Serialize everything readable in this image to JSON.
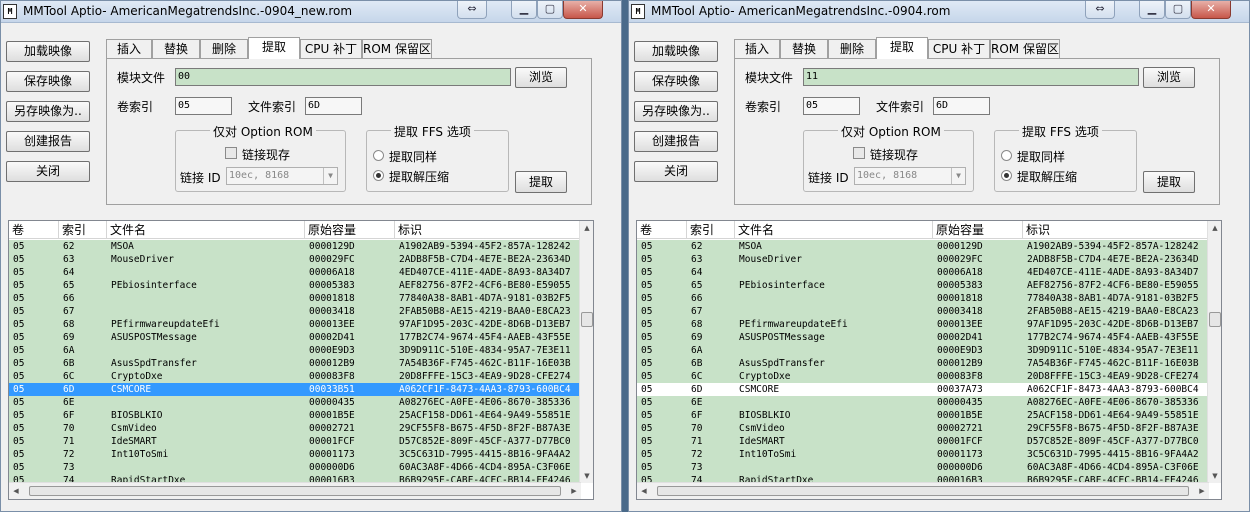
{
  "colors": {
    "row_green": "#c8e2c8",
    "selected": "#3399ff"
  },
  "windows": [
    {
      "title": "MMTool Aptio- AmericanMegatrendsInc.-0904_new.rom",
      "icon_text": "M",
      "side_buttons": [
        "加载映像",
        "保存映像",
        "另存映像为..",
        "创建报告",
        "关闭"
      ],
      "tabs": [
        "插入",
        "替换",
        "删除",
        "提取",
        "CPU 补丁",
        "ROM 保留区"
      ],
      "active_tab": 3,
      "module_file_label": "模块文件",
      "module_file_value": "00",
      "browse": "浏览",
      "volume_label": "卷索引",
      "volume_value": "05",
      "file_index_label": "文件索引",
      "file_index_value": "6D",
      "option_rom_title": "仅对 Option ROM",
      "link_existing": "链接现存",
      "link_id_label": "链接 ID",
      "link_id_value": "10ec, 8168",
      "ffs_title": "提取 FFS 选项",
      "extract_as_is": "提取同样",
      "extract_decompressed": "提取解压缩",
      "extract_button": "提取",
      "columns": [
        "卷",
        "索引",
        "文件名",
        "原始容量",
        "标识"
      ],
      "rows": [
        {
          "vol": "05",
          "idx": "62",
          "name": "MSOA",
          "size": "0000129D",
          "guid": "A1902AB9-5394-45F2-857A-128242",
          "sel": false
        },
        {
          "vol": "05",
          "idx": "63",
          "name": "MouseDriver",
          "size": "000029FC",
          "guid": "2ADB8F5B-C7D4-4E7E-BE2A-23634D",
          "sel": false
        },
        {
          "vol": "05",
          "idx": "64",
          "name": "",
          "size": "00006A18",
          "guid": "4ED407CE-411E-4ADE-8A93-8A34D7",
          "sel": false
        },
        {
          "vol": "05",
          "idx": "65",
          "name": "PEbiosinterface",
          "size": "00005383",
          "guid": "AEF82756-87F2-4CF6-BE80-E59055",
          "sel": false
        },
        {
          "vol": "05",
          "idx": "66",
          "name": "",
          "size": "00001818",
          "guid": "77840A38-8AB1-4D7A-9181-03B2F5",
          "sel": false
        },
        {
          "vol": "05",
          "idx": "67",
          "name": "",
          "size": "00003418",
          "guid": "2FAB50B8-AE15-4219-BAA0-E8CA23",
          "sel": false
        },
        {
          "vol": "05",
          "idx": "68",
          "name": "PEfirmwareupdateEfi",
          "size": "000013EE",
          "guid": "97AF1D95-203C-42DE-8D6B-D13EB7",
          "sel": false
        },
        {
          "vol": "05",
          "idx": "69",
          "name": "ASUSPOSTMessage",
          "size": "00002D41",
          "guid": "177B2C74-9674-45F4-AAEB-43F55E",
          "sel": false
        },
        {
          "vol": "05",
          "idx": "6A",
          "name": "",
          "size": "0000E9D3",
          "guid": "3D9D911C-510E-4834-95A7-7E3E11",
          "sel": false
        },
        {
          "vol": "05",
          "idx": "6B",
          "name": "AsusSpdTransfer",
          "size": "000012B9",
          "guid": "7A54B36F-F745-462C-B11F-16E03B",
          "sel": false
        },
        {
          "vol": "05",
          "idx": "6C",
          "name": "CryptoDxe",
          "size": "000083F8",
          "guid": "20D8FFFE-15C3-4EA9-9D28-CFE274",
          "sel": false
        },
        {
          "vol": "05",
          "idx": "6D",
          "name": "CSMCORE",
          "size": "00033B51",
          "guid": "A062CF1F-8473-4AA3-8793-600BC4",
          "sel": true
        },
        {
          "vol": "05",
          "idx": "6E",
          "name": "",
          "size": "00000435",
          "guid": "A08276EC-A0FE-4E06-8670-385336",
          "sel": false
        },
        {
          "vol": "05",
          "idx": "6F",
          "name": "BIOSBLKIO",
          "size": "00001B5E",
          "guid": "25ACF158-DD61-4E64-9A49-55851E",
          "sel": false
        },
        {
          "vol": "05",
          "idx": "70",
          "name": "CsmVideo",
          "size": "00002721",
          "guid": "29CF55F8-B675-4F5D-8F2F-B87A3E",
          "sel": false
        },
        {
          "vol": "05",
          "idx": "71",
          "name": "IdeSMART",
          "size": "00001FCF",
          "guid": "D57C852E-809F-45CF-A377-D77BC0",
          "sel": false
        },
        {
          "vol": "05",
          "idx": "72",
          "name": "Int10ToSmi",
          "size": "00001173",
          "guid": "3C5C631D-7995-4415-8B16-9FA4A2",
          "sel": false
        },
        {
          "vol": "05",
          "idx": "73",
          "name": "",
          "size": "000000D6",
          "guid": "60AC3A8F-4D66-4CD4-895A-C3F06E",
          "sel": false
        },
        {
          "vol": "05",
          "idx": "74",
          "name": "RapidStartDxe",
          "size": "000016B3",
          "guid": "B6B9295F-CABF-4CEC-BB14-FE4246",
          "sel": false
        }
      ]
    },
    {
      "title": "MMTool Aptio- AmericanMegatrendsInc.-0904.rom",
      "icon_text": "M",
      "side_buttons": [
        "加载映像",
        "保存映像",
        "另存映像为..",
        "创建报告",
        "关闭"
      ],
      "tabs": [
        "插入",
        "替换",
        "删除",
        "提取",
        "CPU 补丁",
        "ROM 保留区"
      ],
      "active_tab": 3,
      "module_file_label": "模块文件",
      "module_file_value": "11",
      "browse": "浏览",
      "volume_label": "卷索引",
      "volume_value": "05",
      "file_index_label": "文件索引",
      "file_index_value": "6D",
      "option_rom_title": "仅对 Option ROM",
      "link_existing": "链接现存",
      "link_id_label": "链接 ID",
      "link_id_value": "10ec, 8168",
      "ffs_title": "提取 FFS 选项",
      "extract_as_is": "提取同样",
      "extract_decompressed": "提取解压缩",
      "extract_button": "提取",
      "columns": [
        "卷",
        "索引",
        "文件名",
        "原始容量",
        "标识"
      ],
      "rows": [
        {
          "vol": "05",
          "idx": "62",
          "name": "MSOA",
          "size": "0000129D",
          "guid": "A1902AB9-5394-45F2-857A-128242",
          "sel": false
        },
        {
          "vol": "05",
          "idx": "63",
          "name": "MouseDriver",
          "size": "000029FC",
          "guid": "2ADB8F5B-C7D4-4E7E-BE2A-23634D",
          "sel": false
        },
        {
          "vol": "05",
          "idx": "64",
          "name": "",
          "size": "00006A18",
          "guid": "4ED407CE-411E-4ADE-8A93-8A34D7",
          "sel": false
        },
        {
          "vol": "05",
          "idx": "65",
          "name": "PEbiosinterface",
          "size": "00005383",
          "guid": "AEF82756-87F2-4CF6-BE80-E59055",
          "sel": false
        },
        {
          "vol": "05",
          "idx": "66",
          "name": "",
          "size": "00001818",
          "guid": "77840A38-8AB1-4D7A-9181-03B2F5",
          "sel": false
        },
        {
          "vol": "05",
          "idx": "67",
          "name": "",
          "size": "00003418",
          "guid": "2FAB50B8-AE15-4219-BAA0-E8CA23",
          "sel": false
        },
        {
          "vol": "05",
          "idx": "68",
          "name": "PEfirmwareupdateEfi",
          "size": "000013EE",
          "guid": "97AF1D95-203C-42DE-8D6B-D13EB7",
          "sel": false
        },
        {
          "vol": "05",
          "idx": "69",
          "name": "ASUSPOSTMessage",
          "size": "00002D41",
          "guid": "177B2C74-9674-45F4-AAEB-43F55E",
          "sel": false
        },
        {
          "vol": "05",
          "idx": "6A",
          "name": "",
          "size": "0000E9D3",
          "guid": "3D9D911C-510E-4834-95A7-7E3E11",
          "sel": false
        },
        {
          "vol": "05",
          "idx": "6B",
          "name": "AsusSpdTransfer",
          "size": "000012B9",
          "guid": "7A54B36F-F745-462C-B11F-16E03B",
          "sel": false
        },
        {
          "vol": "05",
          "idx": "6C",
          "name": "CryptoDxe",
          "size": "000083F8",
          "guid": "20D8FFFE-15C3-4EA9-9D28-CFE274",
          "sel": false
        },
        {
          "vol": "05",
          "idx": "6D",
          "name": "CSMCORE",
          "size": "00037A73",
          "guid": "A062CF1F-8473-4AA3-8793-600BC4",
          "sel": false,
          "plain": true
        },
        {
          "vol": "05",
          "idx": "6E",
          "name": "",
          "size": "00000435",
          "guid": "A08276EC-A0FE-4E06-8670-385336",
          "sel": false
        },
        {
          "vol": "05",
          "idx": "6F",
          "name": "BIOSBLKIO",
          "size": "00001B5E",
          "guid": "25ACF158-DD61-4E64-9A49-55851E",
          "sel": false
        },
        {
          "vol": "05",
          "idx": "70",
          "name": "CsmVideo",
          "size": "00002721",
          "guid": "29CF55F8-B675-4F5D-8F2F-B87A3E",
          "sel": false
        },
        {
          "vol": "05",
          "idx": "71",
          "name": "IdeSMART",
          "size": "00001FCF",
          "guid": "D57C852E-809F-45CF-A377-D77BC0",
          "sel": false
        },
        {
          "vol": "05",
          "idx": "72",
          "name": "Int10ToSmi",
          "size": "00001173",
          "guid": "3C5C631D-7995-4415-8B16-9FA4A2",
          "sel": false
        },
        {
          "vol": "05",
          "idx": "73",
          "name": "",
          "size": "000000D6",
          "guid": "60AC3A8F-4D66-4CD4-895A-C3F06E",
          "sel": false
        },
        {
          "vol": "05",
          "idx": "74",
          "name": "RapidStartDxe",
          "size": "000016B3",
          "guid": "B6B9295F-CABF-4CEC-BB14-FE4246",
          "sel": false
        }
      ]
    }
  ]
}
